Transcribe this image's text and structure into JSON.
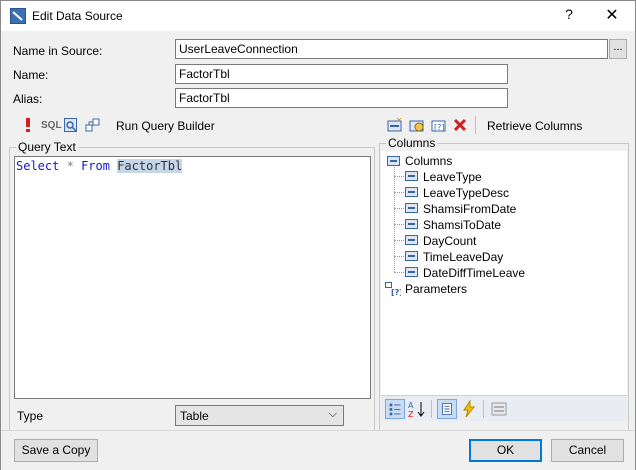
{
  "window": {
    "title": "Edit Data Source",
    "help_label": "?",
    "close_label": "✕"
  },
  "form": {
    "name_in_source_label": "Name in Source:",
    "name_in_source_value": "UserLeaveConnection",
    "browse_label": "...",
    "name_label": "Name:",
    "name_value": "FactorTbl",
    "alias_label": "Alias:",
    "alias_value": "FactorTbl"
  },
  "query_toolbar": {
    "run_icon": "exclamation-icon",
    "sql_label": "SQL",
    "run_query_builder_label": "Run Query Builder"
  },
  "query": {
    "group_label": "Query Text",
    "keyword_select": "Select",
    "operator_star": "*",
    "keyword_from": "From",
    "table_name": "FactorTbl"
  },
  "type": {
    "label": "Type",
    "value": "Table"
  },
  "columns_toolbar": {
    "retrieve_label": "Retrieve Columns"
  },
  "columns": {
    "group_label": "Columns",
    "root_label": "Columns",
    "items": [
      "LeaveType",
      "LeaveTypeDesc",
      "ShamsiFromDate",
      "ShamsiToDate",
      "DayCount",
      "TimeLeaveDay",
      "DateDiffTimeLeave"
    ],
    "parameters_label": "Parameters"
  },
  "footer": {
    "save_copy_label": "Save a Copy",
    "ok_label": "OK",
    "cancel_label": "Cancel"
  },
  "colors": {
    "keyword": "#1515d6",
    "selection": "#c5d7e9",
    "default_button_border": "#0078d7"
  }
}
